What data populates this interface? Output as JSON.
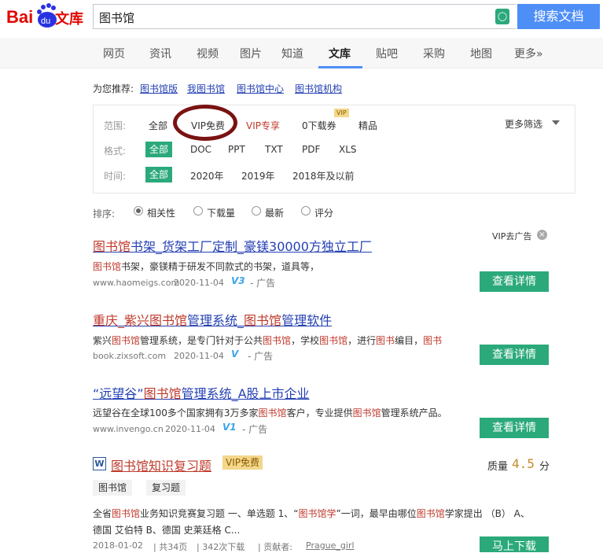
{
  "header": {
    "logo_text_left": "Bai",
    "logo_text_du": "du",
    "logo_text_right": "文库",
    "search_value": "图书馆",
    "camera_icon_glyph": "◯",
    "search_button": "搜索文档"
  },
  "tabs": [
    "网页",
    "资讯",
    "视频",
    "图片",
    "知道",
    "文库",
    "贴吧",
    "采购",
    "地图",
    "更多»"
  ],
  "recommend": {
    "label": "为您推荐:",
    "links": [
      "图书馆版",
      "我图书馆",
      "图书馆中心",
      "图书馆机构"
    ]
  },
  "filters": {
    "scope_label": "范围:",
    "scope_options": [
      "全部",
      "VIP免费",
      "VIP专享",
      "0下载券",
      "精品"
    ],
    "vip_tag": "VIP",
    "format_label": "格式:",
    "format_options": [
      "全部",
      "DOC",
      "PPT",
      "TXT",
      "PDF",
      "XLS"
    ],
    "time_label": "时间:",
    "time_options": [
      "全部",
      "2020年",
      "2019年",
      "2018年及以前"
    ],
    "more": "更多筛选"
  },
  "sort": {
    "label": "排序:",
    "options": [
      "相关性",
      "下载量",
      "最新",
      "评分"
    ],
    "selected": "相关性"
  },
  "ads": {
    "vip_remove": "VIP去广告",
    "button": "查看详情",
    "ad_label": "- 广告"
  },
  "results": [
    {
      "title_parts": [
        "图书馆",
        "书架_货架工厂定制_豪镁30000方独立工厂"
      ],
      "desc_parts": [
        "图书馆",
        "书架，豪镁精于研发不同款式的书架，道具等，"
      ],
      "domain": "www.haomeigs.com",
      "date": "2020-11-04",
      "v": "V3"
    },
    {
      "title_parts": [
        "重庆_紫兴",
        "图书馆",
        "管理系统_",
        "图书馆",
        "管理软件"
      ],
      "desc_parts": [
        "紫兴",
        "图书馆",
        "管理系统，是专门针对于公共",
        "图书馆",
        "，学校",
        "图书馆",
        "，进行",
        "图书",
        "编目，",
        "图书"
      ],
      "domain": "book.zixsoft.com",
      "date": "2020-11-04",
      "v": "V"
    },
    {
      "title_parts": [
        "“远望谷”",
        "图书馆",
        "管理系统_A股上市企业"
      ],
      "desc_parts": [
        "远望谷在全球100多个国家拥有3万多家",
        "图书馆",
        "客户，专业提供",
        "图书馆",
        "管理系统产品。"
      ],
      "domain": "www.invengo.cn",
      "date": "2020-11-04",
      "v": "V1"
    }
  ],
  "doc": {
    "title_parts": [
      "图书馆",
      "知识复习题"
    ],
    "vip_free": "VIP免费",
    "quality_label": "质量",
    "quality_score": "4.5",
    "quality_unit": "分",
    "tags": [
      "图书馆",
      "复习题"
    ],
    "line1_parts": [
      "全省",
      "图书馆",
      "业务知识竞赛复习题 一、单选题 1、“",
      "图书馆学",
      "”一词，最早由哪位",
      "图书馆",
      "学家提出 （B） A、"
    ],
    "line2": "德国 艾伯特 B、德国 史莱廷格 C...",
    "date": "2018-01-02",
    "pages": "共34页",
    "downloads": "342次下载",
    "contributor_label": "贡献者:",
    "contributor": "Prague_girl",
    "download_button": "马上下载"
  }
}
